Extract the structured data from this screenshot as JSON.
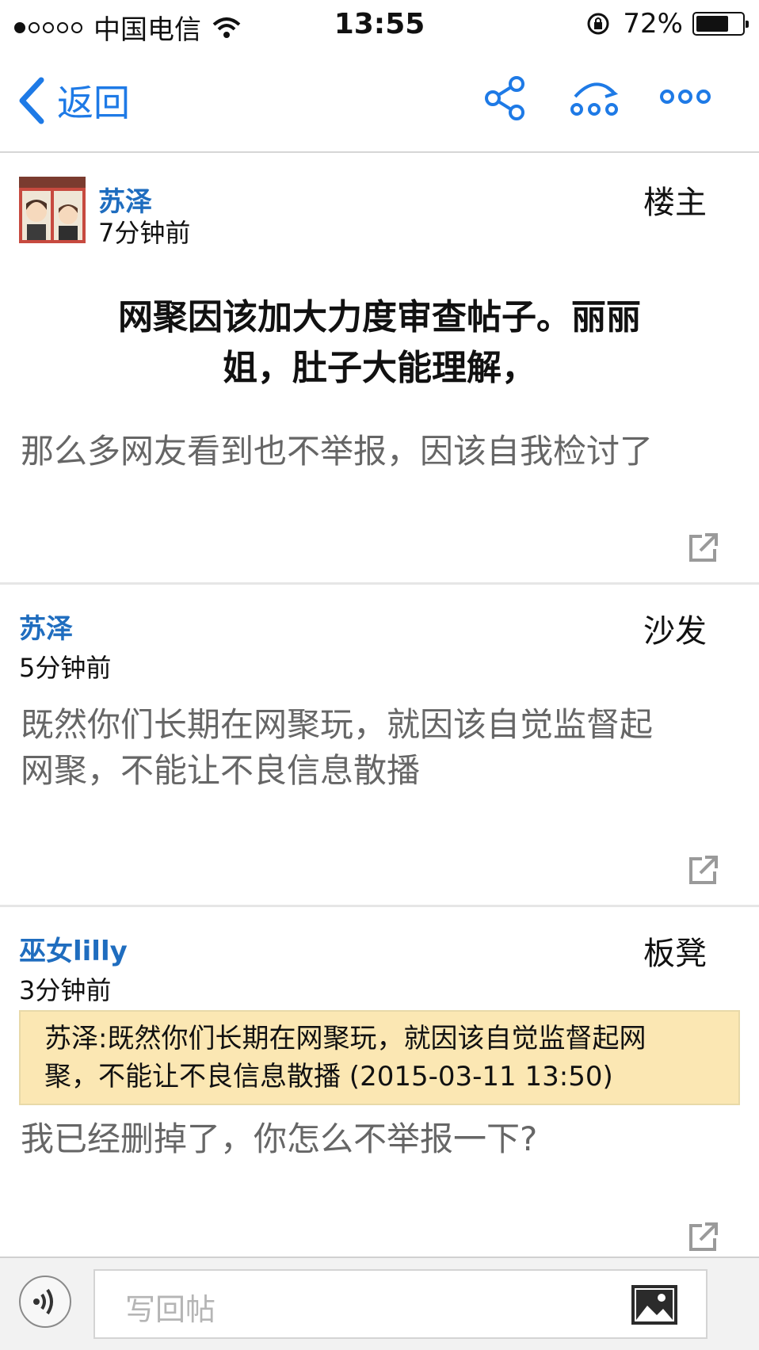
{
  "status_bar": {
    "carrier": "中国电信",
    "time": "13:55",
    "battery_text": "72%",
    "battery_level": 0.72,
    "signal_bars_filled": 1,
    "signal_bars_total": 5
  },
  "nav": {
    "back_label": "返回",
    "icons": [
      "share-icon",
      "more-replies-icon",
      "more-options-icon"
    ],
    "accent": "#1e7ae6"
  },
  "posts": [
    {
      "author": "苏泽",
      "time": "7分钟前",
      "floor": "楼主",
      "title": "网聚因该加大力度审查帖子。丽丽姐，肚子大能理解，",
      "title_line1": "网聚因该加大力度审查帖子。丽丽",
      "title_line2": "姐，肚子大能理解，",
      "body": "那么多网友看到也不举报，因该自我检讨了"
    },
    {
      "author": "苏泽",
      "time": "5分钟前",
      "floor": "沙发",
      "body_line1": "既然你们长期在网聚玩，就因该自觉监督起",
      "body_line2": "网聚，不能让不良信息散播"
    },
    {
      "author": "巫女lilly",
      "time": "3分钟前",
      "floor": "板凳",
      "quote_line1": "苏泽:既然你们长期在网聚玩，就因该自觉监督起网",
      "quote_line2": "聚，不能让不良信息散播 (2015-03-11 13:50)",
      "body": "我已经删掉了，你怎么不举报一下?"
    }
  ],
  "reply_bar": {
    "placeholder": "写回帖"
  },
  "colors": {
    "author": "#1f6dbf",
    "quote_bg": "#fbe7b3",
    "body_text": "#666666"
  }
}
